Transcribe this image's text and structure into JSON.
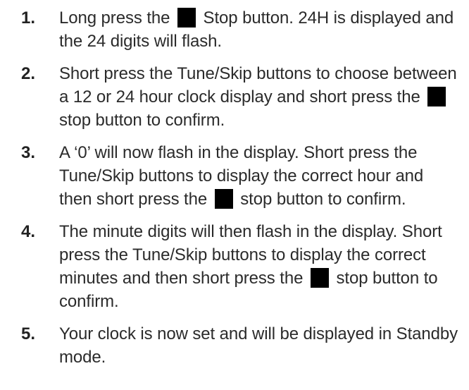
{
  "steps": [
    {
      "number": "1.",
      "parts": [
        "Long press the",
        "Stop button. 24H is displayed and the 24 digits will flash."
      ]
    },
    {
      "number": "2.",
      "parts": [
        "Short press the Tune/Skip buttons to choose between a 12 or 24 hour clock display and short press the",
        "stop button to confirm."
      ]
    },
    {
      "number": "3.",
      "parts": [
        "A ‘0’ will now flash in the display. Short press the Tune/Skip buttons to display the correct hour and then short press the",
        "stop button to confirm."
      ]
    },
    {
      "number": "4.",
      "parts": [
        "The minute digits will then flash in the display. Short press the Tune/Skip buttons to display the correct minutes and then short press the",
        "stop button to confirm."
      ]
    },
    {
      "number": "5.",
      "text": "Your clock is now set and will be displayed in Standby mode."
    }
  ],
  "icons": {
    "stop": "stop-square-icon",
    "stop_color": "#000000"
  }
}
